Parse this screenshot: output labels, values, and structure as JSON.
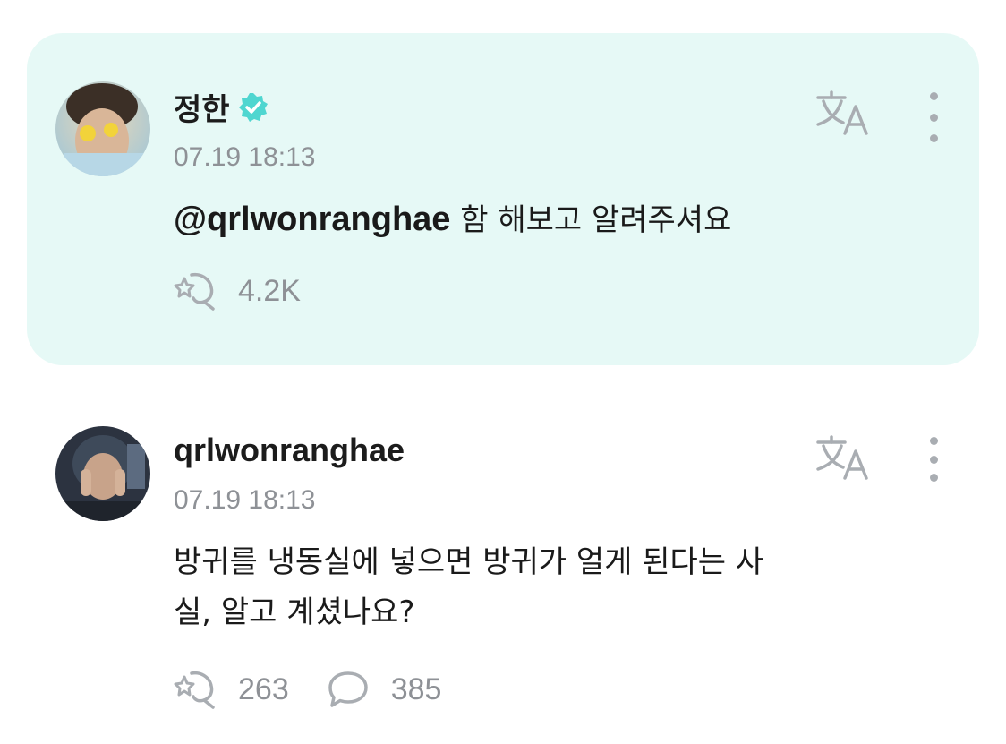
{
  "posts": [
    {
      "author": "정한",
      "verified": true,
      "timestamp": "07.19 18:13",
      "mention": "@qrlwonranghae",
      "text": " 함 해보고 알려주셔요",
      "repost_count": "4.2K"
    },
    {
      "author": "qrlwonranghae",
      "verified": false,
      "timestamp": "07.19 18:13",
      "text_line1": "방귀를 냉동실에 넣으면 방귀가 얼게 된다는 사",
      "text_line2": "실, 알고 계셨나요?",
      "repost_count": "263",
      "comment_count": "385"
    }
  ],
  "icons": {
    "translate": "translate-icon",
    "more": "more-vertical-icon",
    "repost": "repost-icon",
    "comment": "comment-icon",
    "verified": "verified-badge-icon"
  },
  "colors": {
    "highlight_bg": "#e6f9f6",
    "verified_accent": "#4fd6d0",
    "muted_text": "#8e9196"
  }
}
